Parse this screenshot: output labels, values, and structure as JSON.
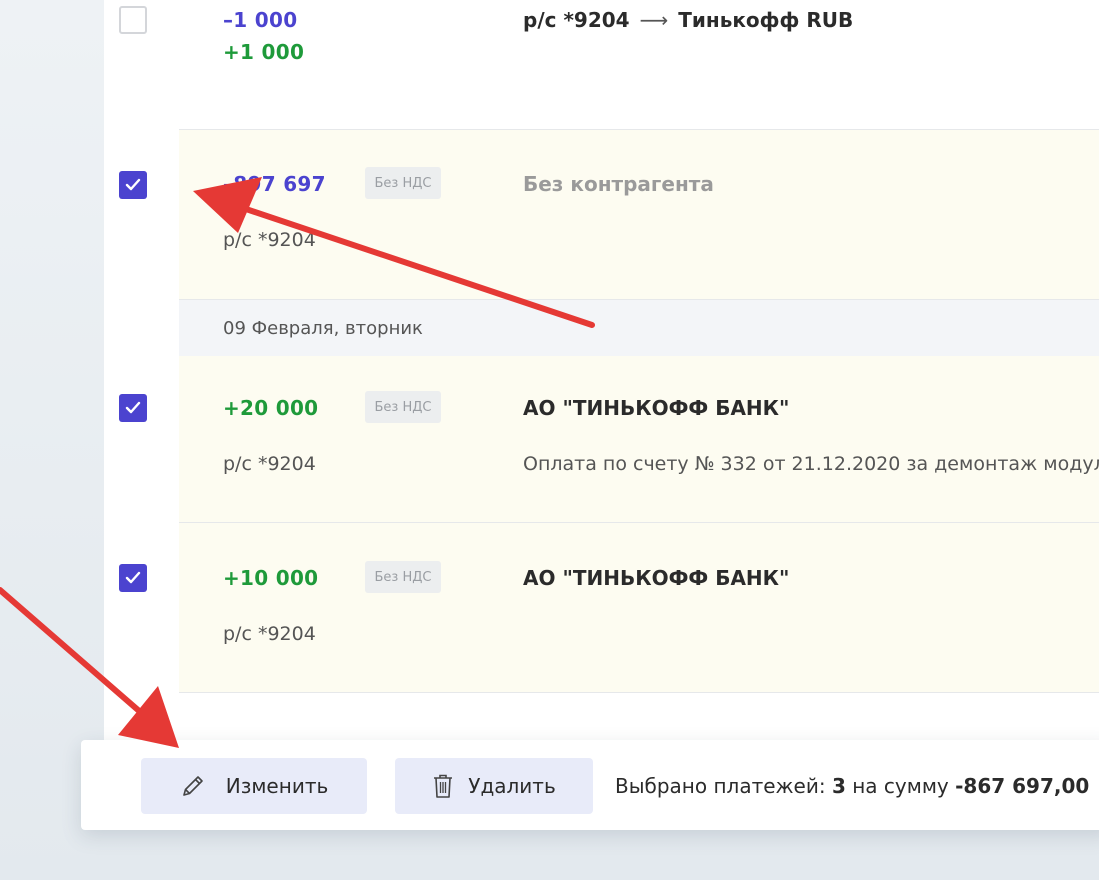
{
  "colors": {
    "accent": "#4b43cf",
    "positive": "#1e9a3a",
    "selected_row_bg": "#fdfcf1",
    "annotation_arrow": "#e53935"
  },
  "transactions": [
    {
      "checked": false,
      "amount_out": "–1 000",
      "amount_in": "+1 000",
      "from": "р/с *9204",
      "arrow": "⟶",
      "to": "Тинькофф RUB"
    },
    {
      "checked": true,
      "amount": "–897 697",
      "vat": "Без НДС",
      "account": "р/с *9204",
      "counterparty": "Без контрагента"
    },
    {
      "checked": true,
      "amount": "+20 000",
      "vat": "Без НДС",
      "account": "р/с *9204",
      "counterparty": "АО \"ТИНЬКОФФ БАНК\"",
      "description": "Оплата по счету № 332 от 21.12.2020 за демонтаж модул"
    },
    {
      "checked": true,
      "amount": "+10 000",
      "vat": "Без НДС",
      "account": "р/с *9204",
      "counterparty": "АО \"ТИНЬКОФФ БАНК\""
    }
  ],
  "date_group": "09 Февраля, вторник",
  "action_bar": {
    "edit_label": "Изменить",
    "delete_label": "Удалить",
    "selected_prefix": "Выбрано платежей: ",
    "selected_count": "3",
    "sum_prefix": " на сумму ",
    "sum_value": "-867 697,00"
  },
  "icons": {
    "edit": "pencil-icon",
    "delete": "trash-icon",
    "check": "checkmark-icon"
  }
}
